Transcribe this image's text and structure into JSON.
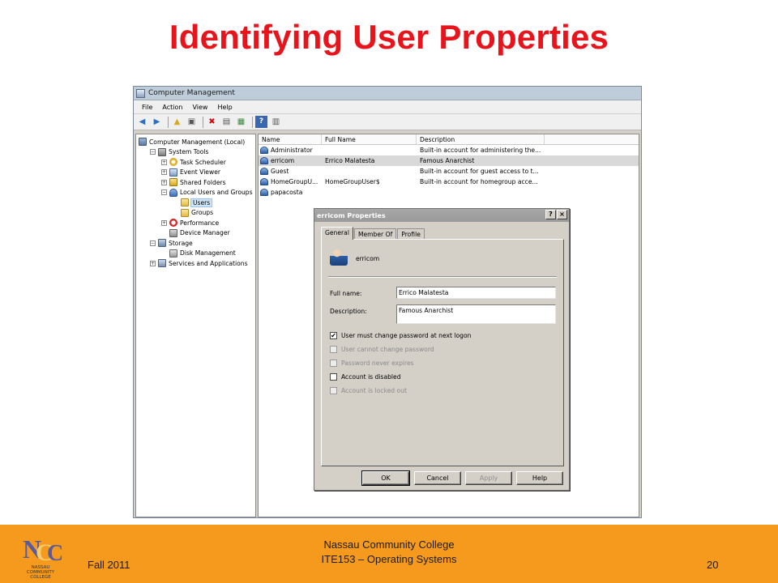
{
  "slide": {
    "title": "Identifying User Properties"
  },
  "window": {
    "title": "Computer Management",
    "menu": [
      "File",
      "Action",
      "View",
      "Help"
    ]
  },
  "tree": [
    {
      "label": "Computer Management (Local)",
      "level": 0,
      "expander": "",
      "icon": "computer-icon"
    },
    {
      "label": "System Tools",
      "level": 1,
      "expander": "−",
      "icon": "tools-icon"
    },
    {
      "label": "Task Scheduler",
      "level": 2,
      "expander": "+",
      "icon": "clock-icon"
    },
    {
      "label": "Event Viewer",
      "level": 2,
      "expander": "+",
      "icon": "event-viewer-icon"
    },
    {
      "label": "Shared Folders",
      "level": 2,
      "expander": "+",
      "icon": "shared-folder-icon"
    },
    {
      "label": "Local Users and Groups",
      "level": 2,
      "expander": "−",
      "icon": "users-icon"
    },
    {
      "label": "Users",
      "level": 3,
      "expander": "",
      "icon": "folder-icon",
      "selected": true
    },
    {
      "label": "Groups",
      "level": 3,
      "expander": "",
      "icon": "folder-icon"
    },
    {
      "label": "Performance",
      "level": 2,
      "expander": "+",
      "icon": "performance-icon"
    },
    {
      "label": "Device Manager",
      "level": 2,
      "expander": "",
      "icon": "device-manager-icon"
    },
    {
      "label": "Storage",
      "level": 1,
      "expander": "−",
      "icon": "storage-icon"
    },
    {
      "label": "Disk Management",
      "level": 2,
      "expander": "",
      "icon": "disk-icon"
    },
    {
      "label": "Services and Applications",
      "level": 1,
      "expander": "+",
      "icon": "services-icon"
    }
  ],
  "list": {
    "columns": [
      "Name",
      "Full Name",
      "Description"
    ],
    "rows": [
      {
        "name": "Administrator",
        "full": "",
        "desc": "Built-in account for administering the..."
      },
      {
        "name": "erricom",
        "full": "Errico Malatesta",
        "desc": "Famous Anarchist",
        "selected": true
      },
      {
        "name": "Guest",
        "full": "",
        "desc": "Built-in account for guest access to t..."
      },
      {
        "name": "HomeGroupU...",
        "full": "HomeGroupUser$",
        "desc": "Built-in account for homegroup acce..."
      },
      {
        "name": "papacosta",
        "full": "",
        "desc": ""
      }
    ]
  },
  "dialog": {
    "title": "erricom Properties",
    "help_btn": "?",
    "close_btn": "×",
    "tabs": [
      "General",
      "Member Of",
      "Profile"
    ],
    "username": "erricom",
    "full_name_label": "Full name:",
    "full_name_value": "Errico Malatesta",
    "description_label": "Description:",
    "description_value": "Famous Anarchist",
    "checkboxes": [
      {
        "label": "User must change password at next logon",
        "checked": true,
        "enabled": true
      },
      {
        "label": "User cannot change password",
        "checked": false,
        "enabled": false
      },
      {
        "label": "Password never expires",
        "checked": false,
        "enabled": false
      },
      {
        "label": "Account is disabled",
        "checked": false,
        "enabled": true
      },
      {
        "label": "Account is locked out",
        "checked": false,
        "enabled": false
      }
    ],
    "buttons": {
      "ok": "OK",
      "cancel": "Cancel",
      "apply": "Apply",
      "help": "Help"
    }
  },
  "footer": {
    "left": "Fall 2011",
    "center_line1": "Nassau Community College",
    "center_line2": "ITE153 – Operating Systems",
    "page": "20",
    "logo_text1": "NASSAU",
    "logo_text2": "COMMUNITY",
    "logo_text3": "COLLEGE"
  },
  "colors": {
    "title": "#e8141c",
    "footer": "#f59a1c"
  }
}
